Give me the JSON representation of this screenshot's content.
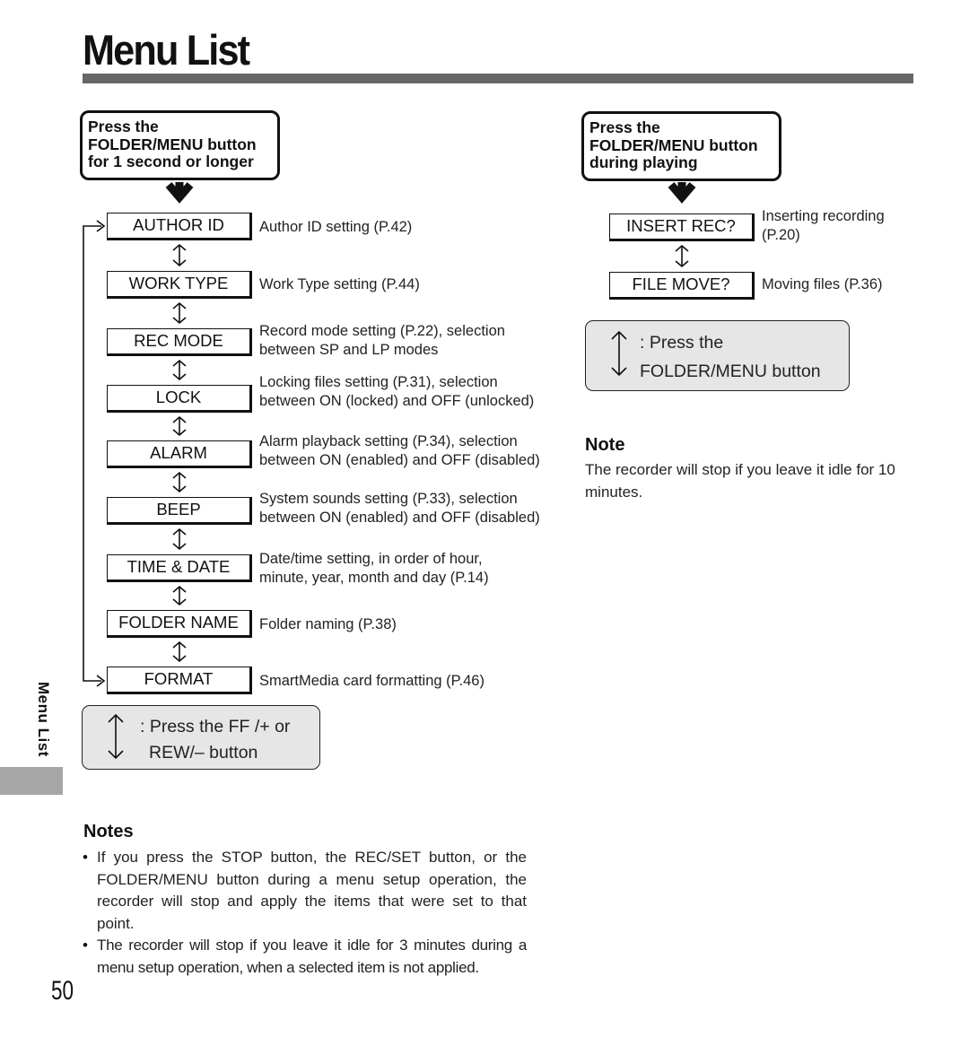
{
  "page": {
    "title": "Menu List",
    "side_tab_label": "Menu List",
    "page_number": "50"
  },
  "left_flow": {
    "start_box": {
      "lines": [
        "Press the",
        "FOLDER/MENU button",
        "for 1 second or longer"
      ]
    },
    "items": [
      {
        "label": "AUTHOR ID",
        "description": [
          "Author ID setting (P.42)"
        ]
      },
      {
        "label": "WORK TYPE",
        "description": [
          "Work Type setting (P.44)"
        ]
      },
      {
        "label": "REC MODE",
        "description": [
          "Record mode setting (P.22), selection",
          "between SP and LP modes"
        ]
      },
      {
        "label": "LOCK",
        "description": [
          "Locking files setting (P.31), selection",
          "between ON (locked) and OFF (unlocked)"
        ]
      },
      {
        "label": "ALARM",
        "description": [
          "Alarm playback setting (P.34), selection",
          "between ON (enabled) and OFF (disabled)"
        ]
      },
      {
        "label": "BEEP",
        "description": [
          "System sounds setting (P.33), selection",
          "between ON (enabled) and OFF (disabled)"
        ]
      },
      {
        "label": "TIME & DATE",
        "description": [
          "Date/time setting, in order of hour,",
          "minute, year, month and day (P.14)"
        ]
      },
      {
        "label": "FOLDER NAME",
        "description": [
          "Folder naming (P.38)"
        ]
      },
      {
        "label": "FORMAT",
        "description": [
          "SmartMedia card formatting (P.46)"
        ]
      }
    ],
    "legend": {
      "icon": "up-down-arrow-icon",
      "lines": [
        ": Press the FF /+ or",
        "REW/– button"
      ]
    }
  },
  "right_flow": {
    "start_box": {
      "lines": [
        "Press the",
        "FOLDER/MENU button",
        "during playing"
      ]
    },
    "items": [
      {
        "label": "INSERT REC?",
        "description": [
          "Inserting recording",
          "(P.20)"
        ]
      },
      {
        "label": "FILE MOVE?",
        "description": [
          "Moving files (P.36)"
        ]
      }
    ],
    "legend": {
      "icon": "up-down-arrow-icon",
      "lines": [
        ": Press the",
        "FOLDER/MENU button"
      ]
    }
  },
  "note": {
    "heading": "Note",
    "text": "The recorder will stop if you leave it idle for 10 minutes."
  },
  "notes": {
    "heading": "Notes",
    "items": [
      "If you press the STOP button, the REC/SET button, or the FOLDER/MENU button during a menu setup operation, the recorder will stop and apply the items that were set to that point.",
      "The recorder will stop if you leave it idle for 3 minutes during a menu setup operation, when a selected item is not applied."
    ]
  }
}
